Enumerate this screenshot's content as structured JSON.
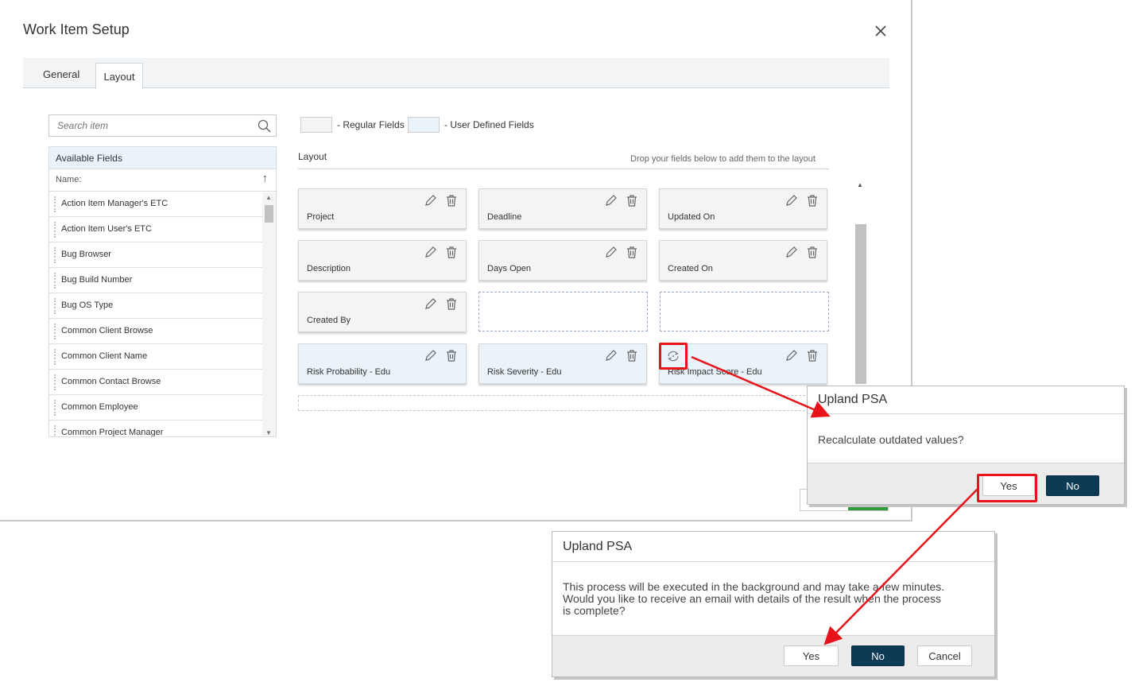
{
  "dialog": {
    "title": "Work Item Setup",
    "tabs": [
      "General",
      "Layout"
    ],
    "active_tab": "Layout"
  },
  "search": {
    "placeholder": "Search item"
  },
  "available_fields": {
    "header": "Available Fields",
    "column": "Name:",
    "items": [
      "Action Item Manager's ETC",
      "Action Item User's ETC",
      "Bug Browser",
      "Bug Build Number",
      "Bug OS Type",
      "Common Client Browse",
      "Common Client Name",
      "Common Contact Browse",
      "Common Employee",
      "Common Project Manager"
    ]
  },
  "legend": {
    "regular": "- Regular Fields",
    "user_defined": "- User Defined Fields"
  },
  "layout": {
    "label": "Layout",
    "hint": "Drop your fields below to add them to the layout",
    "cards": [
      "Project",
      "Deadline",
      "Updated On",
      "Description",
      "Days Open",
      "Created On",
      "Created By",
      "Risk Probability - Edu",
      "Risk Severity - Edu",
      "Risk Impact Score - Edu"
    ]
  },
  "popup1": {
    "title": "Upland PSA",
    "message": "Recalculate outdated values?",
    "yes": "Yes",
    "no": "No"
  },
  "popup2": {
    "title": "Upland PSA",
    "message_lines": [
      "This process will be executed in the background and may take a few minutes.",
      "Would you like to receive an email with details of the result when the process",
      "is complete?"
    ],
    "yes": "Yes",
    "no": "No",
    "cancel": "Cancel"
  },
  "colors": {
    "regular_bg": "#f4f4f4",
    "user_defined_bg": "#eaf3f9",
    "primary_button": "#0d3b55",
    "highlight": "#e8121b"
  }
}
